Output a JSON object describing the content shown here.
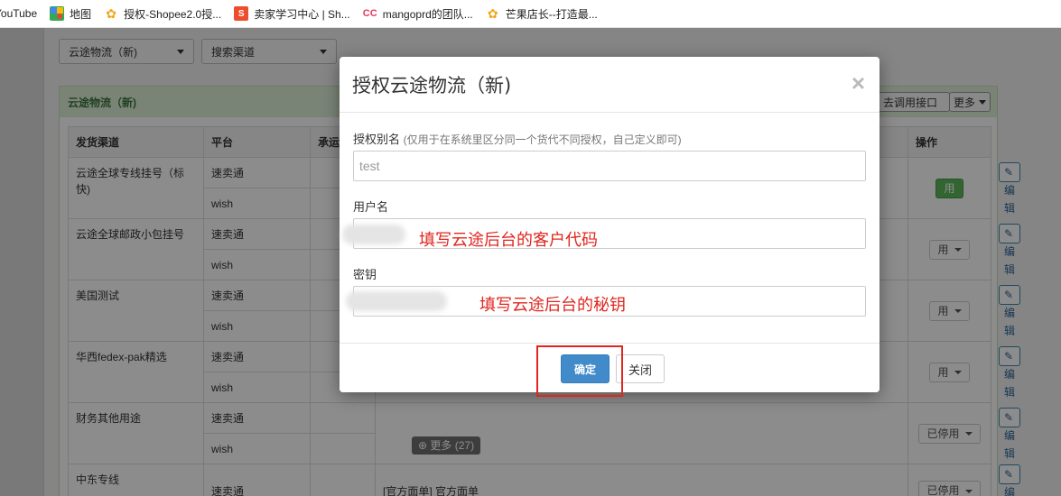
{
  "bookmarks": [
    {
      "label": "YouTube",
      "icon": "youtube-icon",
      "color": "#ff0000"
    },
    {
      "label": "地图",
      "icon": "maps-icon",
      "color": "#34a853"
    },
    {
      "label": "授权-Shopee2.0授...",
      "icon": "mango-icon",
      "color": "#f2a516"
    },
    {
      "label": "卖家学习中心 | Sh...",
      "icon": "shopee-icon",
      "color": "#ee4d2d"
    },
    {
      "label": "mangoprd的团队...",
      "icon": "cc-icon",
      "color": "#e8365d"
    },
    {
      "label": "芒果店长--打造最...",
      "icon": "mango-icon",
      "color": "#f2a516"
    }
  ],
  "filters": {
    "carrier_select": "云途物流（新)",
    "channel_select": "搜索渠道"
  },
  "panel": {
    "title": "云途物流（新)",
    "api_button": "去调用接口",
    "more_button": "更多"
  },
  "table": {
    "headers": [
      "发货渠道",
      "平台",
      "承运",
      "",
      "",
      "操作"
    ],
    "rows": [
      {
        "channel": "云途全球专线挂号（标快)",
        "platforms": [
          "速卖通",
          "wish"
        ],
        "note": "",
        "status": "用",
        "status_green": true
      },
      {
        "channel": "云途全球邮政小包挂号",
        "platforms": [
          "速卖通",
          "wish"
        ],
        "note": "",
        "status": "用",
        "status_green": false
      },
      {
        "channel": "美国测试",
        "platforms": [
          "速卖通",
          "wish"
        ],
        "note": "",
        "status": "用",
        "status_green": false
      },
      {
        "channel": "华西fedex-pak精选",
        "platforms": [
          "速卖通",
          "wish"
        ],
        "note": "",
        "status": "用",
        "status_green": false
      },
      {
        "channel": "财务其他用途",
        "platforms": [
          "速卖通",
          "wish"
        ],
        "note": "",
        "status": "已停用",
        "status_green": false
      },
      {
        "channel": "中东专线",
        "platforms": [
          "速卖通"
        ],
        "note": "[官方面单] 官方面单",
        "status": "已停用",
        "status_green": false
      }
    ],
    "edit_label": "编辑",
    "more_badge": "更多 (27)"
  },
  "modal": {
    "title": "授权云途物流（新)",
    "alias_label": "授权别名",
    "alias_hint": "(仅用于在系统里区分同一个货代不同授权，自己定义即可)",
    "alias_placeholder": "test",
    "username_label": "用户名",
    "username_note": "填写云途后台的客户代码",
    "secret_label": "密钥",
    "secret_note": "填写云途后台的秘钥",
    "confirm_button": "确定",
    "close_button": "关闭",
    "close_icon": "×"
  }
}
